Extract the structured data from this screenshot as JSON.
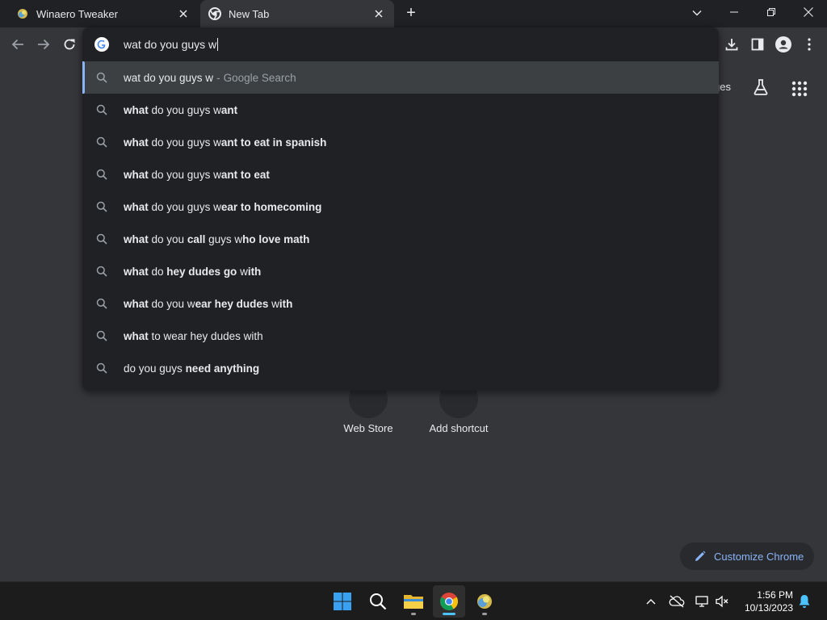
{
  "tabs": [
    {
      "title": "Winaero Tweaker",
      "favicon": "winaero-icon",
      "active": false
    },
    {
      "title": "New Tab",
      "favicon": "chrome-icon",
      "active": true
    }
  ],
  "new_tab_symbol": "+",
  "omnibox": {
    "query": "wat do you guys w",
    "suggestions": [
      {
        "parts": [
          {
            "t": "wat do you guys w",
            "b": false
          }
        ],
        "description": "Google Search",
        "selected": true
      },
      {
        "parts": [
          {
            "t": "what",
            "b": true
          },
          {
            "t": " do you guys w",
            "b": false
          },
          {
            "t": "ant",
            "b": true
          }
        ]
      },
      {
        "parts": [
          {
            "t": "what",
            "b": true
          },
          {
            "t": " do you guys w",
            "b": false
          },
          {
            "t": "ant to eat in spanish",
            "b": true
          }
        ]
      },
      {
        "parts": [
          {
            "t": "what",
            "b": true
          },
          {
            "t": " do you guys w",
            "b": false
          },
          {
            "t": "ant to eat",
            "b": true
          }
        ]
      },
      {
        "parts": [
          {
            "t": "what",
            "b": true
          },
          {
            "t": " do you guys w",
            "b": false
          },
          {
            "t": "ear to homecoming",
            "b": true
          }
        ]
      },
      {
        "parts": [
          {
            "t": "what",
            "b": true
          },
          {
            "t": " do you ",
            "b": false
          },
          {
            "t": "call",
            "b": true
          },
          {
            "t": " guys w",
            "b": false
          },
          {
            "t": "ho love math",
            "b": true
          }
        ]
      },
      {
        "parts": [
          {
            "t": "what",
            "b": true
          },
          {
            "t": " do ",
            "b": false
          },
          {
            "t": "hey dudes go",
            "b": true
          },
          {
            "t": " w",
            "b": false
          },
          {
            "t": "ith",
            "b": true
          }
        ]
      },
      {
        "parts": [
          {
            "t": "what",
            "b": true
          },
          {
            "t": " do you w",
            "b": false
          },
          {
            "t": "ear hey dudes",
            "b": true
          },
          {
            "t": " w",
            "b": false
          },
          {
            "t": "ith",
            "b": true
          }
        ]
      },
      {
        "parts": [
          {
            "t": "what",
            "b": true
          },
          {
            "t": " to wear hey dudes with",
            "b": false
          }
        ]
      },
      {
        "parts": [
          {
            "t": "do you guys ",
            "b": false
          },
          {
            "t": "need anything",
            "b": true
          }
        ]
      }
    ],
    "separator": "-"
  },
  "ntp": {
    "partial_link": "ges",
    "shortcuts": [
      {
        "label": "Web Store"
      },
      {
        "label": "Add shortcut"
      }
    ],
    "customize_label": "Customize Chrome"
  },
  "taskbar": {
    "apps": [
      "windows-start-icon",
      "search-icon",
      "file-explorer-icon",
      "chrome-icon",
      "winaero-tweaker-icon"
    ],
    "time": "1:56 PM",
    "date": "10/13/2023"
  },
  "colors": {
    "accent": "#8ab4f8",
    "omnibox_bg": "#202124",
    "page_bg": "#35363a",
    "selected_row": "#3c4043"
  }
}
